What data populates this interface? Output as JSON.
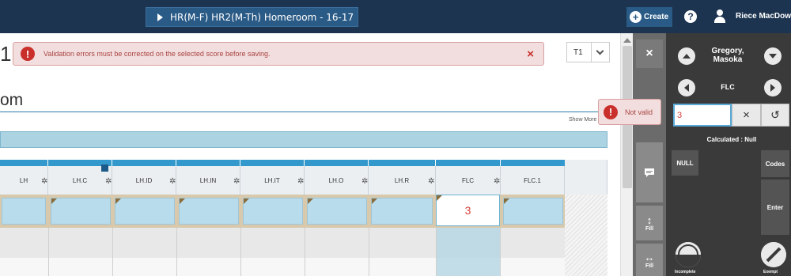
{
  "header": {
    "section_title": "HR(M-F) HR2(M-Th) Homeroom - 16-17",
    "create_label": "Create",
    "help_label": "?",
    "user_name": "Riece MacDowa"
  },
  "page": {
    "title_fragment": "1",
    "subtitle_fragment": "om",
    "show_more": "Show More"
  },
  "alert": {
    "message": "Validation errors must be corrected on the selected score before saving.",
    "close": "×",
    "icon": "!"
  },
  "term_select": {
    "value": "T1"
  },
  "grid": {
    "columns": [
      "LH",
      "LH.C",
      "LH.ID",
      "LH.IN",
      "LH.IT",
      "LH.O",
      "LH.R",
      "FLC",
      "FLC.1"
    ],
    "active_value": "3"
  },
  "validation": {
    "message": "Not valid",
    "icon": "!"
  },
  "tools": {
    "close": "×",
    "fill_vertical": "Fill",
    "fill_horizontal": "Fill"
  },
  "panel": {
    "student_name": "Gregory, Masoka",
    "column_name": "FLC",
    "score_value": "3",
    "clear": "×",
    "undo": "↺",
    "calculated": "Calculated : Null",
    "null_label": "NULL",
    "codes_label": "Codes",
    "enter_label": "Enter",
    "incomplete_label": "Incomplete",
    "exempt_label": "Exempt"
  }
}
